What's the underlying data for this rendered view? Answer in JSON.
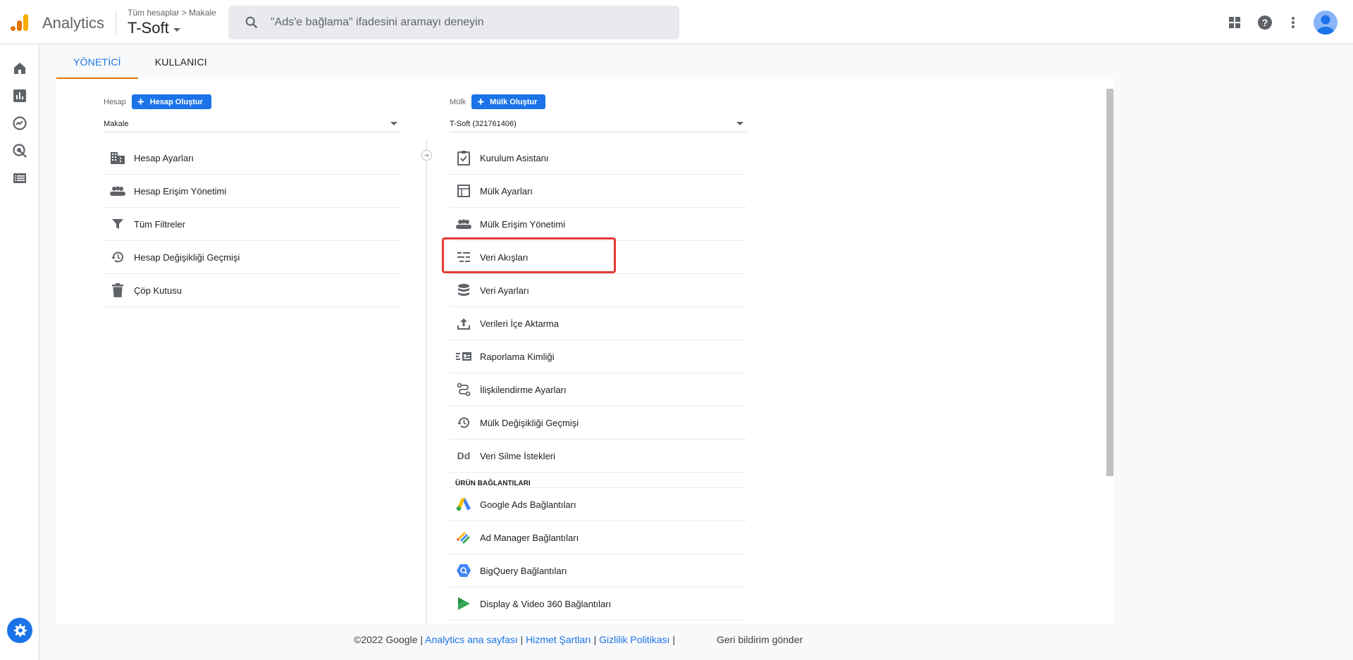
{
  "header": {
    "app_name": "Analytics",
    "breadcrumb": "Tüm hesaplar > Makale",
    "account_name": "T-Soft",
    "search_placeholder": "\"Ads'e bağlama\" ifadesini aramayı deneyin"
  },
  "tabs": [
    {
      "label": "YÖNETİCİ",
      "active": true
    },
    {
      "label": "KULLANICI",
      "active": false
    }
  ],
  "account": {
    "heading": "Hesap",
    "create_label": "Hesap Oluştur",
    "selected": "Makale",
    "items": [
      {
        "label": "Hesap Ayarları",
        "icon": "building-icon"
      },
      {
        "label": "Hesap Erişim Yönetimi",
        "icon": "people-icon"
      },
      {
        "label": "Tüm Filtreler",
        "icon": "filter-icon"
      },
      {
        "label": "Hesap Değişikliği Geçmişi",
        "icon": "history-icon"
      },
      {
        "label": "Çöp Kutusu",
        "icon": "trash-icon"
      }
    ]
  },
  "property": {
    "heading": "Mülk",
    "create_label": "Mülk Oluştur",
    "selected": "T-Soft (321761406)",
    "items": [
      {
        "label": "Kurulum Asistanı",
        "icon": "checklist-icon"
      },
      {
        "label": "Mülk Ayarları",
        "icon": "layout-icon"
      },
      {
        "label": "Mülk Erişim Yönetimi",
        "icon": "people-icon"
      },
      {
        "label": "Veri Akışları",
        "icon": "streams-icon"
      },
      {
        "label": "Veri Ayarları",
        "icon": "database-icon"
      },
      {
        "label": "Verileri İçe Aktarma",
        "icon": "upload-icon"
      },
      {
        "label": "Raporlama Kimliği",
        "icon": "reporting-id-icon"
      },
      {
        "label": "İlişkilendirme Ayarları",
        "icon": "attribution-icon"
      },
      {
        "label": "Mülk Değişikliği Geçmişi",
        "icon": "history-icon"
      },
      {
        "label": "Veri Silme İstekleri",
        "icon": "dd-icon"
      }
    ],
    "product_links_heading": "ÜRÜN BAĞLANTILARI",
    "product_links": [
      {
        "label": "Google Ads Bağlantıları",
        "icon": "google-ads-icon"
      },
      {
        "label": "Ad Manager Bağlantıları",
        "icon": "ad-manager-icon"
      },
      {
        "label": "BigQuery Bağlantıları",
        "icon": "bigquery-icon"
      },
      {
        "label": "Display & Video 360 Bağlantıları",
        "icon": "dv360-icon"
      }
    ]
  },
  "footer": {
    "copyright": "©2022 Google |",
    "home_link": "Analytics ana sayfası",
    "sep1": "|",
    "terms_link": "Hizmet Şartları",
    "sep2": "|",
    "privacy_link": "Gizlilik Politikası",
    "sep3": "|",
    "feedback": "Geri bildirim gönder"
  },
  "colors": {
    "primary": "#1a73e8",
    "highlight": "#e53935",
    "tab_underline": "#e37400"
  }
}
